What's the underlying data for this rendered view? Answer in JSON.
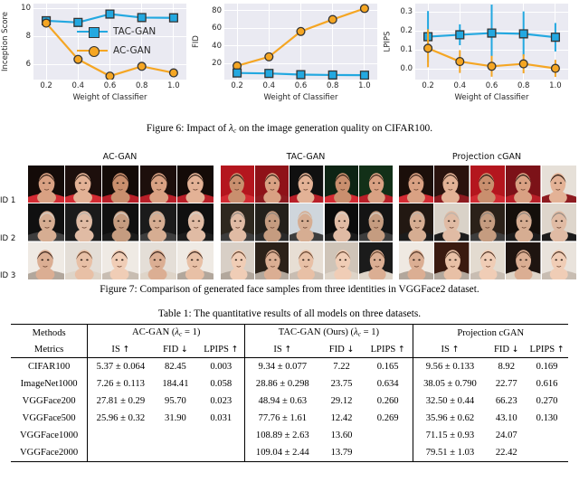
{
  "figure6": {
    "caption": "Figure 6: Impact of λc on the image generation quality on CIFAR100.",
    "legend": [
      {
        "label": "TAC-GAN",
        "color": "#23a8e0",
        "marker": "square"
      },
      {
        "label": "AC-GAN",
        "color": "#f5a623",
        "marker": "circle"
      }
    ],
    "charts": [
      {
        "ylabel": "Inception Score",
        "xlabel": "Weight of Classifier",
        "yticks": [
          "6",
          "8",
          "10"
        ],
        "xticks": [
          "0.2",
          "0.4",
          "0.6",
          "0.8",
          "1.0"
        ]
      },
      {
        "ylabel": "FID",
        "xlabel": "Weight of Classifier",
        "yticks": [
          "20",
          "40",
          "60",
          "80"
        ],
        "xticks": [
          "0.2",
          "0.4",
          "0.6",
          "0.8",
          "1.0"
        ]
      },
      {
        "ylabel": "LPIPS",
        "xlabel": "Weight of Classifier",
        "yticks": [
          "0.0",
          "0.1",
          "0.2",
          "0.3"
        ],
        "xticks": [
          "0.2",
          "0.4",
          "0.6",
          "0.8",
          "1.0"
        ]
      }
    ]
  },
  "chart_data": [
    {
      "type": "line",
      "title": "",
      "xlabel": "Weight of Classifier",
      "ylabel": "Inception Score",
      "x": [
        0.2,
        0.4,
        0.6,
        0.8,
        1.0
      ],
      "xlim": [
        0.12,
        1.08
      ],
      "ylim": [
        4.9,
        10.35
      ],
      "ytick_values": [
        6,
        8,
        10
      ],
      "grid": true,
      "legend_position": "center-right-inside",
      "series": [
        {
          "name": "TAC-GAN",
          "color": "#23a8e0",
          "marker": "square",
          "values": [
            9.12,
            9.0,
            9.6,
            9.35,
            9.33
          ],
          "err": [
            0.22,
            0.12,
            0.14,
            0.12,
            0.12
          ]
        },
        {
          "name": "AC-GAN",
          "color": "#f5a623",
          "marker": "circle",
          "values": [
            8.95,
            6.35,
            5.15,
            5.85,
            5.38
          ],
          "err": [
            0.18,
            0.1,
            0.1,
            0.1,
            0.1
          ]
        }
      ]
    },
    {
      "type": "line",
      "title": "",
      "xlabel": "Weight of Classifier",
      "ylabel": "FID",
      "x": [
        0.2,
        0.4,
        0.6,
        0.8,
        1.0
      ],
      "xlim": [
        0.12,
        1.08
      ],
      "ylim": [
        2,
        88
      ],
      "ytick_values": [
        20,
        40,
        60,
        80
      ],
      "grid": true,
      "legend_position": "none",
      "series": [
        {
          "name": "AC-GAN",
          "color": "#f5a623",
          "marker": "circle",
          "values": [
            17.5,
            27.8,
            56.5,
            70.0,
            82.5
          ]
        },
        {
          "name": "TAC-GAN",
          "color": "#23a8e0",
          "marker": "square",
          "values": [
            9.5,
            9.0,
            7.6,
            7.2,
            7.0
          ]
        }
      ]
    },
    {
      "type": "line",
      "title": "",
      "xlabel": "Weight of Classifier",
      "ylabel": "LPIPS",
      "x": [
        0.2,
        0.4,
        0.6,
        0.8,
        1.0
      ],
      "xlim": [
        0.12,
        1.08
      ],
      "ylim": [
        -0.055,
        0.345
      ],
      "ytick_values": [
        0.0,
        0.1,
        0.2,
        0.3
      ],
      "grid": true,
      "legend_position": "none",
      "series": [
        {
          "name": "TAC-GAN",
          "color": "#23a8e0",
          "marker": "square",
          "values": [
            0.171,
            0.181,
            0.19,
            0.186,
            0.168
          ],
          "err": [
            0.135,
            0.055,
            0.15,
            0.118,
            0.075
          ]
        },
        {
          "name": "AC-GAN",
          "color": "#f5a623",
          "marker": "circle",
          "values": [
            0.11,
            0.04,
            0.015,
            0.028,
            0.004
          ],
          "err": [
            0.1,
            0.06,
            0.055,
            0.05,
            0.045
          ]
        }
      ]
    }
  ],
  "figure7": {
    "caption": "Figure 7: Comparison of generated face samples from three identities in VGGFace2 dataset.",
    "groups": [
      "AC-GAN",
      "TAC-GAN",
      "Projection cGAN"
    ],
    "row_labels": [
      "ID 1",
      "ID 2",
      "ID 3"
    ]
  },
  "table1": {
    "caption": "Table 1: The quantitative results of all models on three datasets.",
    "group_header_label": "Methods",
    "metric_header_label": "Metrics",
    "groups": [
      "AC-GAN (λc = 1)",
      "TAC-GAN (Ours) (λc = 1)",
      "Projection cGAN"
    ],
    "metrics": [
      "IS ↑",
      "FID ↓",
      "LPIPS ↑"
    ],
    "rows": [
      {
        "name": "CIFAR100",
        "cells": [
          {
            "v": "5.37 ± 0.064",
            "bold": false
          },
          {
            "v": "82.45",
            "bold": false
          },
          {
            "v": "0.003",
            "bold": false
          },
          {
            "v": "9.34 ± 0.077",
            "bold": false
          },
          {
            "v": "7.22",
            "bold": true
          },
          {
            "v": "0.165",
            "bold": false
          },
          {
            "v": "9.56 ± 0.133",
            "bold": true
          },
          {
            "v": "8.92",
            "bold": false
          },
          {
            "v": "0.169",
            "bold": true
          }
        ]
      },
      {
        "name": "ImageNet1000",
        "cells": [
          {
            "v": "7.26 ± 0.113",
            "bold": false
          },
          {
            "v": "184.41",
            "bold": false
          },
          {
            "v": "0.058",
            "bold": false
          },
          {
            "v": "28.86 ± 0.298",
            "bold": false
          },
          {
            "v": "23.75",
            "bold": false
          },
          {
            "v": "0.634",
            "bold": true
          },
          {
            "v": "38.05 ± 0.790",
            "bold": true
          },
          {
            "v": "22.77",
            "bold": true
          },
          {
            "v": "0.616",
            "bold": false
          }
        ]
      },
      {
        "name": "VGGFace200",
        "cells": [
          {
            "v": "27.81 ± 0.29",
            "bold": false
          },
          {
            "v": "95.70",
            "bold": false
          },
          {
            "v": "0.023",
            "bold": false
          },
          {
            "v": "48.94 ± 0.63",
            "bold": true
          },
          {
            "v": "29.12",
            "bold": true
          },
          {
            "v": "0.260",
            "bold": false
          },
          {
            "v": "32.50 ± 0.44",
            "bold": false
          },
          {
            "v": "66.23",
            "bold": false
          },
          {
            "v": "0.270",
            "bold": true
          }
        ]
      },
      {
        "name": "VGGFace500",
        "cells": [
          {
            "v": "25.96 ± 0.32",
            "bold": false
          },
          {
            "v": "31.90",
            "bold": false
          },
          {
            "v": "0.031",
            "bold": false
          },
          {
            "v": "77.76 ± 1.61",
            "bold": true
          },
          {
            "v": "12.42",
            "bold": true
          },
          {
            "v": "0.269",
            "bold": true
          },
          {
            "v": "35.96 ± 0.62",
            "bold": false
          },
          {
            "v": "43.10",
            "bold": false
          },
          {
            "v": "0.130",
            "bold": false
          }
        ]
      },
      {
        "name": "VGGFace1000",
        "cells": [
          {
            "v": "",
            "bold": false
          },
          {
            "v": "",
            "bold": false
          },
          {
            "v": "",
            "bold": false
          },
          {
            "v": "108.89 ± 2.63",
            "bold": true
          },
          {
            "v": "13.60",
            "bold": true
          },
          {
            "v": "",
            "bold": false
          },
          {
            "v": "71.15 ± 0.93",
            "bold": false
          },
          {
            "v": "24.07",
            "bold": false
          },
          {
            "v": "",
            "bold": false
          }
        ]
      },
      {
        "name": "VGGFace2000",
        "cells": [
          {
            "v": "",
            "bold": false
          },
          {
            "v": "",
            "bold": false
          },
          {
            "v": "",
            "bold": false
          },
          {
            "v": "109.04 ± 2.44",
            "bold": true
          },
          {
            "v": "13.79",
            "bold": true
          },
          {
            "v": "",
            "bold": false
          },
          {
            "v": "79.51 ± 1.03",
            "bold": false
          },
          {
            "v": "22.42",
            "bold": false
          },
          {
            "v": "",
            "bold": false
          }
        ]
      }
    ]
  },
  "colors": {
    "tac_gan": "#23a8e0",
    "ac_gan": "#f5a623",
    "plot_bg": "#eaeaf2",
    "grid": "#ffffff",
    "text": "#262626"
  }
}
